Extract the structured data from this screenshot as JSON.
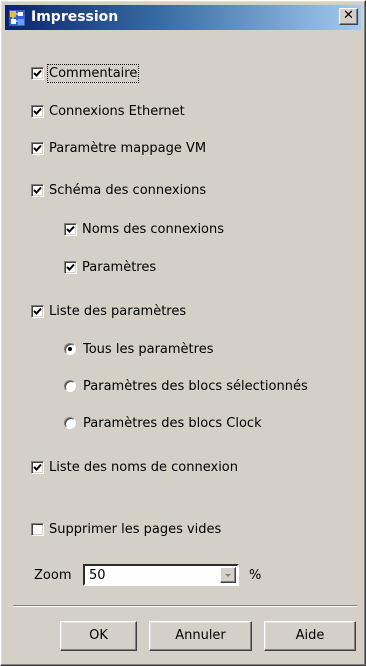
{
  "window": {
    "title": "Impression",
    "close_symbol": "✕",
    "icon": "print-settings-icon"
  },
  "options": {
    "commentaire": {
      "label": "Commentaire",
      "checked": true
    },
    "connexions_ethernet": {
      "label": "Connexions Ethernet",
      "checked": true
    },
    "parametre_mappage_vm": {
      "label": "Paramètre mappage VM",
      "checked": true
    },
    "schema_connexions": {
      "label": "Schéma des connexions",
      "checked": true
    },
    "noms_connexions": {
      "label": "Noms des connexions",
      "checked": true
    },
    "parametres": {
      "label": "Paramètres",
      "checked": true
    },
    "liste_parametres": {
      "label": "Liste des paramètres",
      "checked": true
    },
    "tous_parametres": {
      "label": "Tous les paramètres",
      "selected": true
    },
    "parametres_blocs_selectionnes": {
      "label": "Paramètres des blocs sélectionnés",
      "selected": false
    },
    "parametres_blocs_clock": {
      "label": "Paramètres des blocs Clock",
      "selected": false
    },
    "liste_noms_connexion": {
      "label": "Liste des noms de connexion",
      "checked": true
    },
    "supprimer_pages_vides": {
      "label": "Supprimer les pages vides",
      "checked": false
    }
  },
  "zoom": {
    "label": "Zoom",
    "value": "50",
    "unit": "%"
  },
  "buttons": {
    "ok": "OK",
    "annuler": "Annuler",
    "aide": "Aide"
  }
}
